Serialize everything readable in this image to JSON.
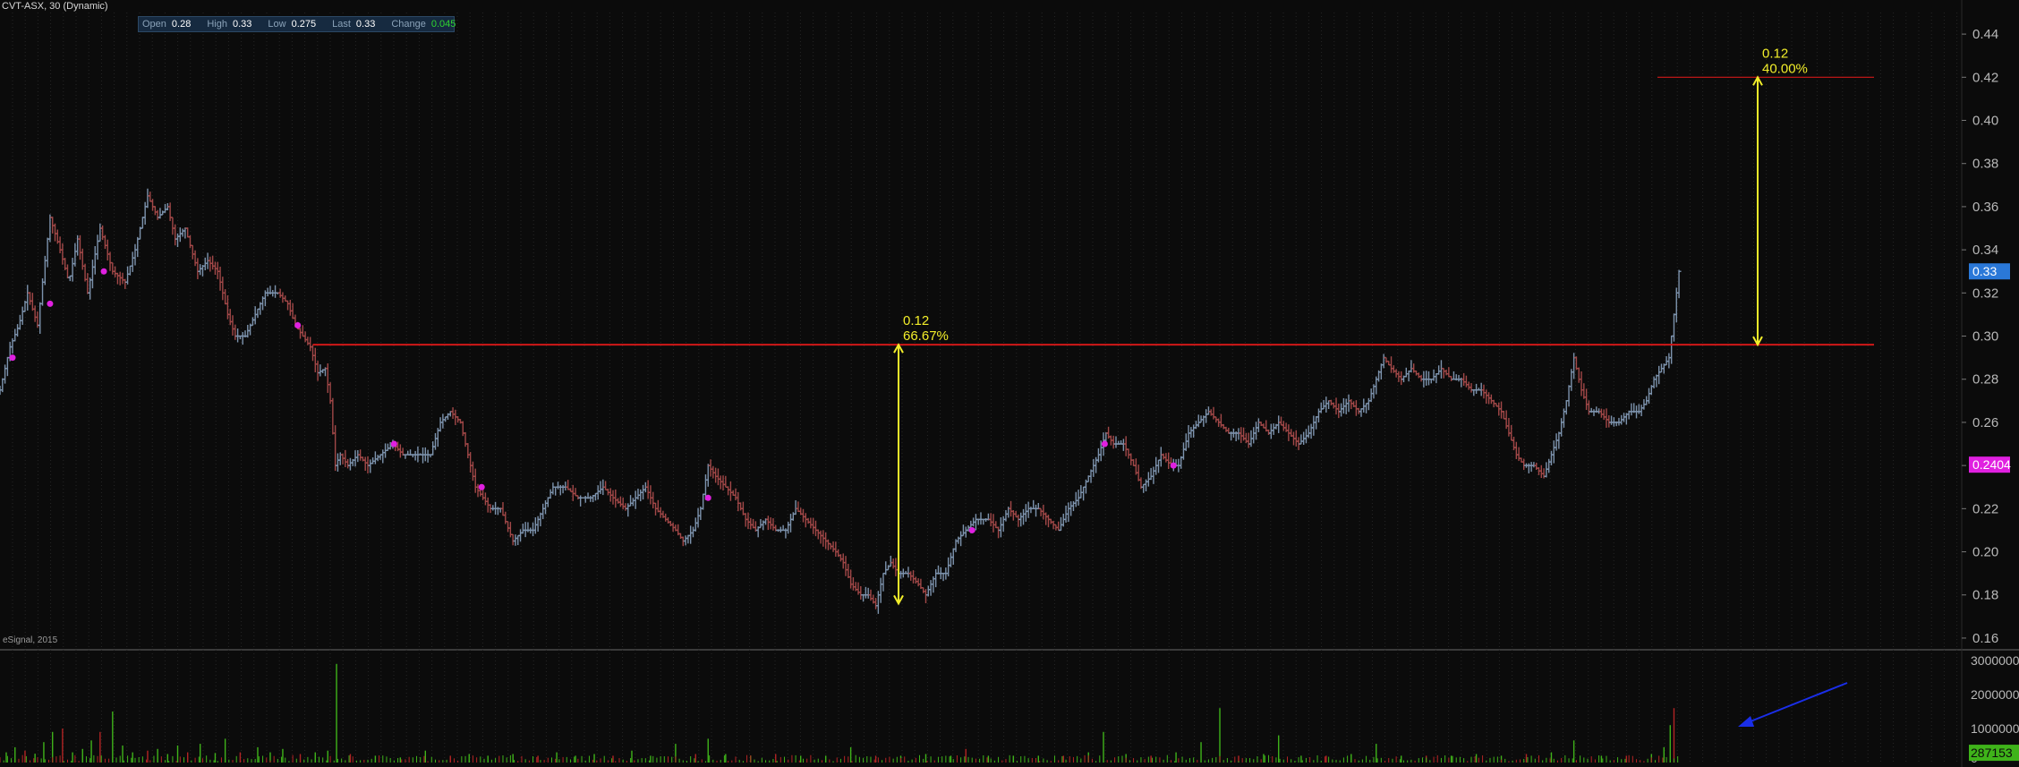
{
  "title": "CVT-ASX, 30 (Dynamic)",
  "quote": {
    "open_label": "Open",
    "open": "0.28",
    "high_label": "High",
    "high": "0.33",
    "low_label": "Low",
    "low": "0.275",
    "last_label": "Last",
    "last": "0.33",
    "change_label": "Change",
    "change": "0.045"
  },
  "watermark": "eSignal, 2015",
  "colors": {
    "background": "#0b0b0b",
    "up_bar": "#7d93ad",
    "down_bar": "#a24848",
    "up_volume": "#3fb31a",
    "down_volume": "#b32424",
    "resistance_line": "#d01818",
    "measure_arrow": "#f2ee2a",
    "marker_dot": "#e020e0",
    "last_price_tag": "#2a78d8",
    "indicator_tag": "#e020e0",
    "volume_tag": "#3fb31a",
    "annotation_arrow": "#1a2ee8"
  },
  "chart_data": [
    {
      "type": "ohlc",
      "symbol": "CVT-ASX",
      "interval": "30",
      "y_ticks": [
        "0.44",
        "0.42",
        "0.40",
        "0.38",
        "0.36",
        "0.34",
        "0.32",
        "0.30",
        "0.28",
        "0.26",
        "0.24",
        "0.22",
        "0.20",
        "0.18",
        "0.16"
      ],
      "ylim": [
        0.155,
        0.45
      ],
      "grid": true,
      "price_path": [
        [
          0,
          0.275
        ],
        [
          8,
          0.295
        ],
        [
          15,
          0.305
        ],
        [
          22,
          0.32
        ],
        [
          30,
          0.305
        ],
        [
          40,
          0.355
        ],
        [
          48,
          0.34
        ],
        [
          55,
          0.325
        ],
        [
          62,
          0.345
        ],
        [
          70,
          0.32
        ],
        [
          80,
          0.35
        ],
        [
          90,
          0.33
        ],
        [
          100,
          0.325
        ],
        [
          108,
          0.34
        ],
        [
          118,
          0.365
        ],
        [
          126,
          0.355
        ],
        [
          134,
          0.36
        ],
        [
          140,
          0.345
        ],
        [
          148,
          0.35
        ],
        [
          158,
          0.33
        ],
        [
          166,
          0.335
        ],
        [
          174,
          0.33
        ],
        [
          182,
          0.31
        ],
        [
          188,
          0.3
        ],
        [
          196,
          0.3
        ],
        [
          204,
          0.31
        ],
        [
          212,
          0.32
        ],
        [
          222,
          0.32
        ],
        [
          230,
          0.315
        ],
        [
          236,
          0.305
        ],
        [
          242,
          0.3
        ],
        [
          248,
          0.295
        ],
        [
          254,
          0.283
        ],
        [
          260,
          0.285
        ],
        [
          264,
          0.27
        ],
        [
          268,
          0.24
        ],
        [
          272,
          0.245
        ],
        [
          278,
          0.24
        ],
        [
          286,
          0.245
        ],
        [
          294,
          0.24
        ],
        [
          304,
          0.245
        ],
        [
          314,
          0.25
        ],
        [
          322,
          0.245
        ],
        [
          334,
          0.245
        ],
        [
          344,
          0.245
        ],
        [
          352,
          0.26
        ],
        [
          360,
          0.265
        ],
        [
          368,
          0.26
        ],
        [
          374,
          0.245
        ],
        [
          380,
          0.23
        ],
        [
          386,
          0.225
        ],
        [
          392,
          0.22
        ],
        [
          400,
          0.22
        ],
        [
          410,
          0.205
        ],
        [
          418,
          0.21
        ],
        [
          426,
          0.21
        ],
        [
          434,
          0.22
        ],
        [
          442,
          0.23
        ],
        [
          452,
          0.23
        ],
        [
          462,
          0.225
        ],
        [
          472,
          0.225
        ],
        [
          482,
          0.23
        ],
        [
          490,
          0.225
        ],
        [
          500,
          0.22
        ],
        [
          508,
          0.225
        ],
        [
          516,
          0.23
        ],
        [
          524,
          0.22
        ],
        [
          532,
          0.215
        ],
        [
          540,
          0.21
        ],
        [
          546,
          0.205
        ],
        [
          554,
          0.21
        ],
        [
          560,
          0.22
        ],
        [
          566,
          0.24
        ],
        [
          572,
          0.235
        ],
        [
          580,
          0.23
        ],
        [
          588,
          0.225
        ],
        [
          596,
          0.215
        ],
        [
          604,
          0.21
        ],
        [
          612,
          0.215
        ],
        [
          620,
          0.21
        ],
        [
          628,
          0.21
        ],
        [
          636,
          0.22
        ],
        [
          644,
          0.215
        ],
        [
          652,
          0.21
        ],
        [
          660,
          0.205
        ],
        [
          668,
          0.2
        ],
        [
          674,
          0.195
        ],
        [
          680,
          0.185
        ],
        [
          688,
          0.18
        ],
        [
          694,
          0.18
        ],
        [
          700,
          0.175
        ],
        [
          706,
          0.19
        ],
        [
          712,
          0.195
        ],
        [
          718,
          0.19
        ],
        [
          726,
          0.19
        ],
        [
          734,
          0.185
        ],
        [
          740,
          0.18
        ],
        [
          748,
          0.19
        ],
        [
          756,
          0.19
        ],
        [
          764,
          0.205
        ],
        [
          772,
          0.21
        ],
        [
          780,
          0.215
        ],
        [
          790,
          0.215
        ],
        [
          798,
          0.21
        ],
        [
          806,
          0.22
        ],
        [
          814,
          0.215
        ],
        [
          822,
          0.22
        ],
        [
          830,
          0.22
        ],
        [
          838,
          0.215
        ],
        [
          846,
          0.21
        ],
        [
          854,
          0.22
        ],
        [
          862,
          0.225
        ],
        [
          870,
          0.235
        ],
        [
          878,
          0.245
        ],
        [
          884,
          0.255
        ],
        [
          890,
          0.25
        ],
        [
          898,
          0.25
        ],
        [
          906,
          0.24
        ],
        [
          912,
          0.23
        ],
        [
          920,
          0.235
        ],
        [
          928,
          0.245
        ],
        [
          936,
          0.24
        ],
        [
          942,
          0.24
        ],
        [
          950,
          0.255
        ],
        [
          958,
          0.26
        ],
        [
          966,
          0.265
        ],
        [
          974,
          0.26
        ],
        [
          982,
          0.255
        ],
        [
          990,
          0.255
        ],
        [
          998,
          0.25
        ],
        [
          1006,
          0.26
        ],
        [
          1014,
          0.255
        ],
        [
          1022,
          0.26
        ],
        [
          1030,
          0.255
        ],
        [
          1038,
          0.25
        ],
        [
          1046,
          0.255
        ],
        [
          1054,
          0.265
        ],
        [
          1062,
          0.27
        ],
        [
          1070,
          0.265
        ],
        [
          1078,
          0.27
        ],
        [
          1086,
          0.265
        ],
        [
          1094,
          0.27
        ],
        [
          1100,
          0.28
        ],
        [
          1106,
          0.29
        ],
        [
          1112,
          0.285
        ],
        [
          1120,
          0.28
        ],
        [
          1128,
          0.285
        ],
        [
          1136,
          0.28
        ],
        [
          1144,
          0.28
        ],
        [
          1152,
          0.285
        ],
        [
          1160,
          0.28
        ],
        [
          1168,
          0.28
        ],
        [
          1176,
          0.275
        ],
        [
          1184,
          0.275
        ],
        [
          1192,
          0.27
        ],
        [
          1200,
          0.265
        ],
        [
          1206,
          0.255
        ],
        [
          1212,
          0.245
        ],
        [
          1218,
          0.24
        ],
        [
          1226,
          0.24
        ],
        [
          1234,
          0.235
        ],
        [
          1240,
          0.245
        ],
        [
          1246,
          0.255
        ],
        [
          1252,
          0.27
        ],
        [
          1258,
          0.29
        ],
        [
          1264,
          0.275
        ],
        [
          1270,
          0.265
        ],
        [
          1278,
          0.265
        ],
        [
          1286,
          0.26
        ],
        [
          1294,
          0.26
        ],
        [
          1302,
          0.265
        ],
        [
          1310,
          0.265
        ],
        [
          1316,
          0.27
        ],
        [
          1322,
          0.28
        ],
        [
          1328,
          0.285
        ],
        [
          1334,
          0.29
        ],
        [
          1338,
          0.31
        ],
        [
          1342,
          0.33
        ]
      ],
      "markers": [
        [
          10,
          0.29
        ],
        [
          40,
          0.315
        ],
        [
          83,
          0.33
        ],
        [
          238,
          0.305
        ],
        [
          315,
          0.25
        ],
        [
          385,
          0.23
        ],
        [
          566,
          0.225
        ],
        [
          777,
          0.21
        ],
        [
          883,
          0.25
        ],
        [
          938,
          0.24
        ]
      ],
      "resistance_level": 0.296,
      "target_level": 0.42,
      "measure_1": {
        "change": "0.12",
        "percent": "66.67%",
        "from": 0.176,
        "to": 0.296
      },
      "measure_2": {
        "change": "0.12",
        "percent": "40.00%",
        "from": 0.296,
        "to": 0.42
      },
      "last_price_tag": "0.33",
      "indicator_tag": "0.2404"
    },
    {
      "type": "bar",
      "name": "volume",
      "y_ticks": [
        "3000000",
        "2000000",
        "1000000",
        "0"
      ],
      "ylim": [
        0,
        3000000
      ],
      "last_volume_tag": "287153",
      "spikes": [
        [
          5,
          300000
        ],
        [
          12,
          450000
        ],
        [
          20,
          350000
        ],
        [
          28,
          260000
        ],
        [
          35,
          600000
        ],
        [
          42,
          900000
        ],
        [
          50,
          1000000
        ],
        [
          58,
          300000
        ],
        [
          66,
          400000
        ],
        [
          73,
          650000
        ],
        [
          80,
          900000
        ],
        [
          90,
          1500000
        ],
        [
          98,
          500000
        ],
        [
          106,
          300000
        ],
        [
          118,
          350000
        ],
        [
          126,
          400000
        ],
        [
          134,
          250000
        ],
        [
          142,
          500000
        ],
        [
          150,
          300000
        ],
        [
          160,
          550000
        ],
        [
          172,
          280000
        ],
        [
          180,
          700000
        ],
        [
          192,
          300000
        ],
        [
          206,
          450000
        ],
        [
          216,
          300000
        ],
        [
          226,
          400000
        ],
        [
          240,
          250000
        ],
        [
          252,
          300000
        ],
        [
          262,
          350000
        ],
        [
          269,
          2900000
        ],
        [
          280,
          250000
        ],
        [
          300,
          200000
        ],
        [
          320,
          150000
        ],
        [
          340,
          350000
        ],
        [
          360,
          200000
        ],
        [
          375,
          250000
        ],
        [
          390,
          200000
        ],
        [
          410,
          250000
        ],
        [
          430,
          200000
        ],
        [
          445,
          300000
        ],
        [
          460,
          200000
        ],
        [
          475,
          250000
        ],
        [
          490,
          200000
        ],
        [
          505,
          350000
        ],
        [
          520,
          200000
        ],
        [
          540,
          550000
        ],
        [
          556,
          250000
        ],
        [
          566,
          700000
        ],
        [
          580,
          250000
        ],
        [
          600,
          200000
        ],
        [
          620,
          250000
        ],
        [
          640,
          200000
        ],
        [
          660,
          200000
        ],
        [
          680,
          450000
        ],
        [
          700,
          200000
        ],
        [
          720,
          200000
        ],
        [
          740,
          250000
        ],
        [
          760,
          200000
        ],
        [
          772,
          400000
        ],
        [
          790,
          200000
        ],
        [
          810,
          200000
        ],
        [
          830,
          200000
        ],
        [
          850,
          200000
        ],
        [
          870,
          300000
        ],
        [
          882,
          900000
        ],
        [
          900,
          250000
        ],
        [
          920,
          200000
        ],
        [
          940,
          300000
        ],
        [
          960,
          600000
        ],
        [
          975,
          1600000
        ],
        [
          990,
          200000
        ],
        [
          1010,
          250000
        ],
        [
          1022,
          800000
        ],
        [
          1040,
          200000
        ],
        [
          1060,
          200000
        ],
        [
          1080,
          250000
        ],
        [
          1100,
          550000
        ],
        [
          1120,
          200000
        ],
        [
          1140,
          200000
        ],
        [
          1160,
          200000
        ],
        [
          1180,
          250000
        ],
        [
          1200,
          200000
        ],
        [
          1220,
          250000
        ],
        [
          1240,
          300000
        ],
        [
          1258,
          650000
        ],
        [
          1280,
          200000
        ],
        [
          1300,
          200000
        ],
        [
          1320,
          250000
        ],
        [
          1330,
          450000
        ],
        [
          1335,
          1100000
        ],
        [
          1338,
          1600000
        ]
      ]
    }
  ]
}
